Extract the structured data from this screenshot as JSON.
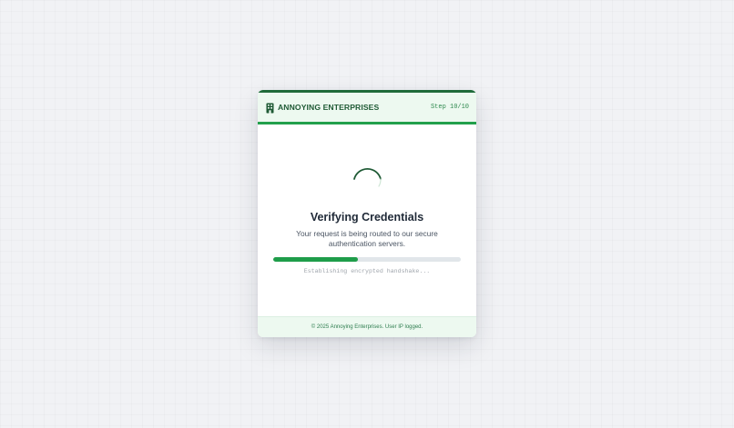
{
  "header": {
    "brand_name": "ANNOYING ENTERPRISES",
    "brand_icon": "building-icon",
    "step": "Step 10/10"
  },
  "main": {
    "spinner_icon": "loading-spinner-icon",
    "title": "Verifying Credentials",
    "subtitle": "Your request is being routed to our secure authentication servers.",
    "progress_fraction": 0.45,
    "progress_text": "Establishing encrypted handshake..."
  },
  "footer": {
    "text": "© 2025 Annoying Enterprises. User IP logged."
  },
  "colors": {
    "accent_dark": "#1f6b3a",
    "accent": "#22a04b",
    "header_bg": "#edf9f0",
    "page_bg": "#f1f2f5"
  }
}
